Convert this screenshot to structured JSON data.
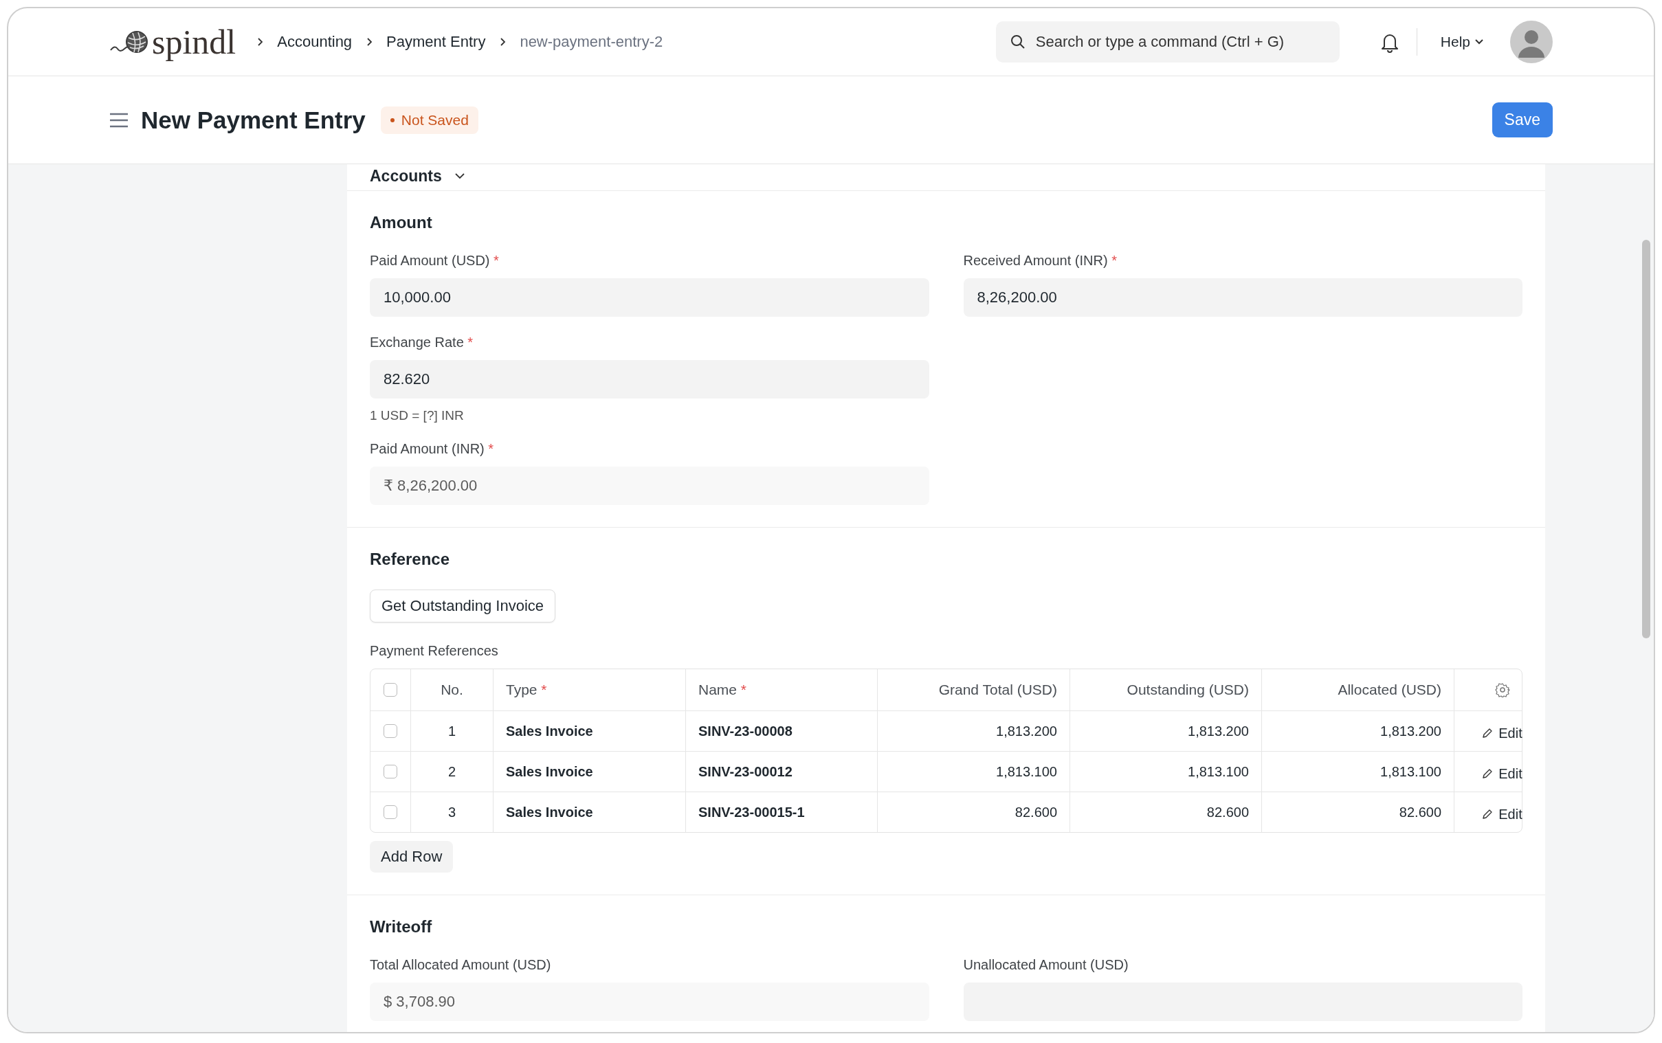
{
  "nav": {
    "logo": "spindl",
    "breadcrumbs": [
      {
        "label": "Accounting",
        "current": false
      },
      {
        "label": "Payment Entry",
        "current": false
      },
      {
        "label": "new-payment-entry-2",
        "current": true
      }
    ],
    "search": {
      "placeholder": "Search or type a command (Ctrl + G)"
    },
    "help": "Help"
  },
  "page": {
    "title": "New Payment Entry",
    "status": "Not Saved",
    "save": "Save"
  },
  "accounts": {
    "title": "Accounts"
  },
  "amount": {
    "title": "Amount",
    "columns": [
      [
        {
          "label": "Paid Amount (USD)",
          "required_mark": "*",
          "value": "10,000.00",
          "read_only": false
        },
        {
          "label": "Exchange Rate",
          "required_mark": "*",
          "value": "82.620",
          "read_only": false,
          "hint": "1 USD = [?] INR"
        },
        {
          "label": "Paid Amount (INR)",
          "required_mark": "*",
          "value": "₹ 8,26,200.00",
          "read_only": true
        }
      ],
      [
        {
          "label": "Received Amount (INR)",
          "required_mark": "*",
          "value": "8,26,200.00",
          "read_only": false
        }
      ]
    ]
  },
  "reference": {
    "title": "Reference",
    "button": "Get Outstanding Invoice",
    "table_label": "Payment References",
    "header_checked": false,
    "columns": [
      {
        "label": "No."
      },
      {
        "label": "Type",
        "required_mark": "*"
      },
      {
        "label": "Name",
        "required_mark": "*"
      },
      {
        "label": "Grand Total (USD)"
      },
      {
        "label": "Outstanding (USD)"
      },
      {
        "label": "Allocated (USD)"
      }
    ],
    "rows": [
      {
        "checked": false,
        "cells": [
          "1",
          "Sales Invoice",
          "SINV-23-00008",
          "1,813.200",
          "1,813.200",
          "1,813.200"
        ],
        "edit": "Edit"
      },
      {
        "checked": false,
        "cells": [
          "2",
          "Sales Invoice",
          "SINV-23-00012",
          "1,813.100",
          "1,813.100",
          "1,813.100"
        ],
        "edit": "Edit"
      },
      {
        "checked": false,
        "cells": [
          "3",
          "Sales Invoice",
          "SINV-23-00015-1",
          "82.600",
          "82.600",
          "82.600"
        ],
        "edit": "Edit"
      }
    ],
    "add_row": "Add Row"
  },
  "writeoff": {
    "title": "Writeoff",
    "columns": [
      [
        {
          "label": "Total Allocated Amount (USD)",
          "value": "$ 3,708.90",
          "read_only": true
        }
      ],
      [
        {
          "label": "Unallocated Amount (USD)"
        }
      ]
    ]
  }
}
